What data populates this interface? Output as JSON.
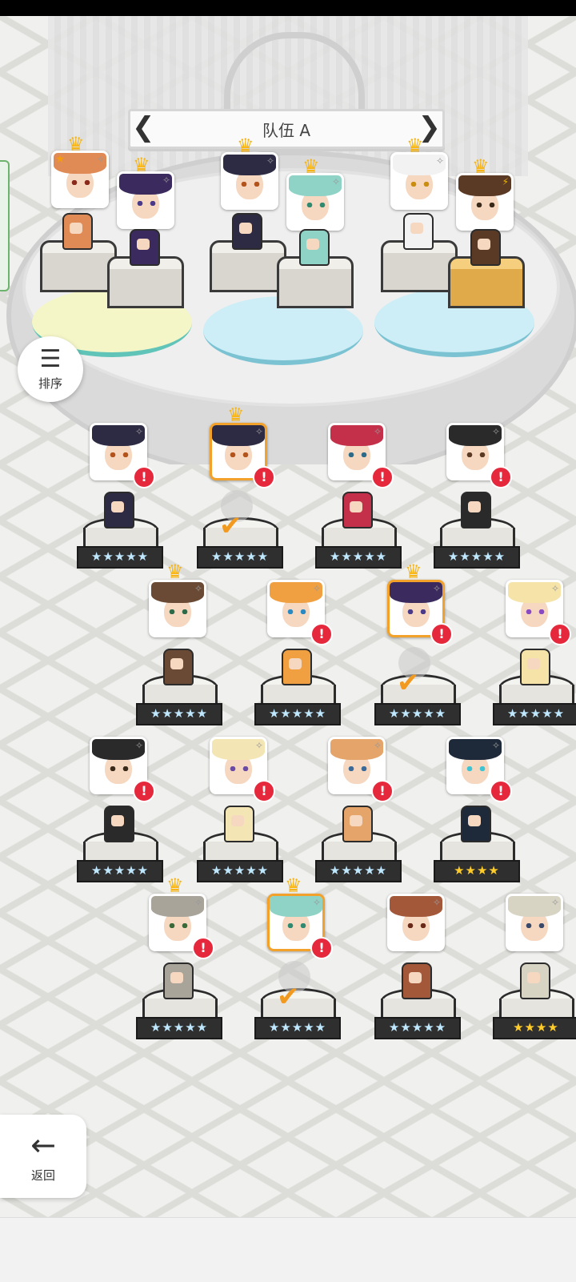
{
  "team": {
    "title": "队伍 A",
    "prev_arrow": "❮",
    "next_arrow": "❯"
  },
  "sort_button": {
    "icon": "☰",
    "label": "排序"
  },
  "back_button": {
    "icon": "←",
    "label": "返回"
  },
  "glyphs": {
    "crown": "♛",
    "alert": "!",
    "check": "✔",
    "sparkle": "✧",
    "star_corner": "★",
    "bolt": "⚡"
  },
  "party_slots": [
    {
      "hair": "#e08a55",
      "eye": "#8b2a1a",
      "crown": true,
      "corner": "star"
    },
    {
      "hair": "#3b2a5e",
      "eye": "#4a3a8a",
      "crown": true,
      "corner": "sparkle"
    },
    {
      "hair": "#2d2a44",
      "eye": "#b2541c",
      "crown": true,
      "corner": "sparkle"
    },
    {
      "hair": "#8ed3c6",
      "eye": "#2f8a6f",
      "crown": true,
      "corner": "sparkle"
    },
    {
      "hair": "#f2f2f2",
      "eye": "#c98d12",
      "crown": true,
      "corner": "sparkle"
    },
    {
      "hair": "#5a3a24",
      "eye": "#3a2a1a",
      "crown": true,
      "corner": "bolt"
    }
  ],
  "roster": [
    {
      "hair": "#2d2a44",
      "eye": "#b2541c",
      "stars": "★★★★★",
      "gold": false,
      "crown": false,
      "selected": false,
      "alert": true,
      "in_team": false
    },
    {
      "hair": "#2d2a44",
      "eye": "#b2541c",
      "stars": "★★★★★",
      "gold": false,
      "crown": true,
      "selected": true,
      "alert": true,
      "in_team": true
    },
    {
      "hair": "#c4304a",
      "eye": "#2c6b8a",
      "stars": "★★★★★",
      "gold": false,
      "crown": false,
      "selected": false,
      "alert": true,
      "in_team": false
    },
    {
      "hair": "#2a2a2a",
      "eye": "#5a3a24",
      "stars": "★★★★★",
      "gold": false,
      "crown": false,
      "selected": false,
      "alert": true,
      "in_team": false
    },
    {
      "hair": "#6a4a34",
      "eye": "#2c6b4a",
      "stars": "★★★★★",
      "gold": false,
      "crown": true,
      "selected": false,
      "alert": false,
      "in_team": false
    },
    {
      "hair": "#f0a040",
      "eye": "#2a8ac4",
      "stars": "★★★★★",
      "gold": false,
      "crown": false,
      "selected": false,
      "alert": true,
      "in_team": false
    },
    {
      "hair": "#3b2a5e",
      "eye": "#4a3a8a",
      "stars": "★★★★★",
      "gold": false,
      "crown": true,
      "selected": true,
      "alert": true,
      "in_team": true
    },
    {
      "hair": "#f6e3a8",
      "eye": "#8a4ac4",
      "stars": "★★★★★",
      "gold": false,
      "crown": false,
      "selected": false,
      "alert": true,
      "in_team": false
    },
    {
      "hair": "#2a2a2a",
      "eye": "#3a2a1a",
      "stars": "★★★★★",
      "gold": false,
      "crown": false,
      "selected": false,
      "alert": true,
      "in_team": false
    },
    {
      "hair": "#f4e6b4",
      "eye": "#6a4aa4",
      "stars": "★★★★★",
      "gold": false,
      "crown": false,
      "selected": false,
      "alert": true,
      "in_team": false
    },
    {
      "hair": "#e4a46a",
      "eye": "#3a6a9a",
      "stars": "★★★★★",
      "gold": false,
      "crown": false,
      "selected": false,
      "alert": true,
      "in_team": false
    },
    {
      "hair": "#1e2a3a",
      "eye": "#3ac4d4",
      "stars": "★★★★",
      "gold": true,
      "crown": false,
      "selected": false,
      "alert": true,
      "in_team": false
    },
    {
      "hair": "#a8a49a",
      "eye": "#3a6a3a",
      "stars": "★★★★★",
      "gold": false,
      "crown": true,
      "selected": false,
      "alert": true,
      "in_team": false
    },
    {
      "hair": "#8ed3c6",
      "eye": "#2f8a6f",
      "stars": "★★★★★",
      "gold": false,
      "crown": true,
      "selected": true,
      "alert": true,
      "in_team": true
    },
    {
      "hair": "#a4583a",
      "eye": "#6a2a1a",
      "stars": "★★★★★",
      "gold": false,
      "crown": false,
      "selected": false,
      "alert": false,
      "in_team": false
    },
    {
      "hair": "#d8d4c4",
      "eye": "#3a4a6a",
      "stars": "★★★★",
      "gold": true,
      "crown": false,
      "selected": false,
      "alert": false,
      "in_team": false
    }
  ]
}
